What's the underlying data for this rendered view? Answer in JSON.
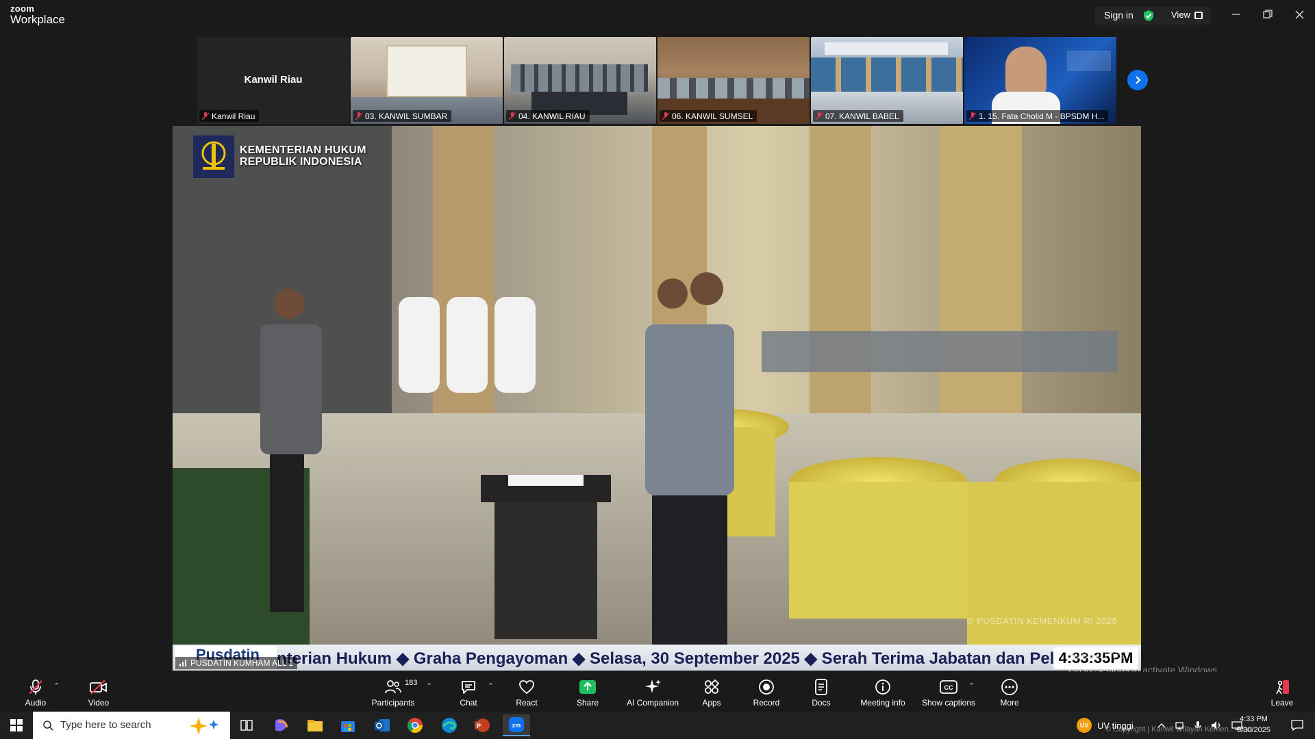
{
  "window": {
    "brand_top": "zoom",
    "brand_bottom": "Workplace",
    "sign_in": "Sign in",
    "view": "View"
  },
  "thumbnails": [
    {
      "name": "Kanwil Riau",
      "center": "Kanwil Riau"
    },
    {
      "name": "03. KANWIL SUMBAR"
    },
    {
      "name": "04. KANWIL RIAU"
    },
    {
      "name": "06. KANWIL SUMSEL"
    },
    {
      "name": "07. KANWIL BABEL"
    },
    {
      "name": "1. 15. Fata Cholid M - BPSDM H..."
    }
  ],
  "main_video": {
    "logo_line1": "KEMENTERIAN HUKUM",
    "logo_line2": "REPUBLIK INDONESIA",
    "watermark": "© PUSDATIN KEMENKUM RI 2025",
    "ticker_logo": "Pusdatin",
    "ticker_text": "nterian Hukum  ◆  Graha Pengayoman  ◆  Selasa, 30 September 2025  ◆  Serah Terima Jabatan dan Pel",
    "clock": "4:33:35PM",
    "participant": "PUSDATIN KUMHAM ALL 1"
  },
  "activation": {
    "line1": "Windows",
    "line2": "Go to Settings to activate Windows."
  },
  "toolbar": {
    "audio": "Audio",
    "video": "Video",
    "participants": "Participants",
    "participants_count": "183",
    "chat": "Chat",
    "react": "React",
    "share": "Share",
    "ai_companion": "AI Companion",
    "apps": "Apps",
    "record": "Record",
    "docs": "Docs",
    "meeting_info": "Meeting info",
    "show_captions": "Show captions",
    "more": "More",
    "leave": "Leave"
  },
  "taskbar": {
    "search_placeholder": "Type here to search",
    "weather": "UV tinggi",
    "weather_badge": "UV",
    "time": "4:33 PM",
    "date": "9/30/2025",
    "overlay_text": "© Copyright | Kanwil Wilayah Kemen... Riau"
  },
  "colors": {
    "accent_blue": "#0e72ed",
    "share_green": "#1fbf5f",
    "muted_red": "#e8384f",
    "shield_green": "#22c55e"
  }
}
